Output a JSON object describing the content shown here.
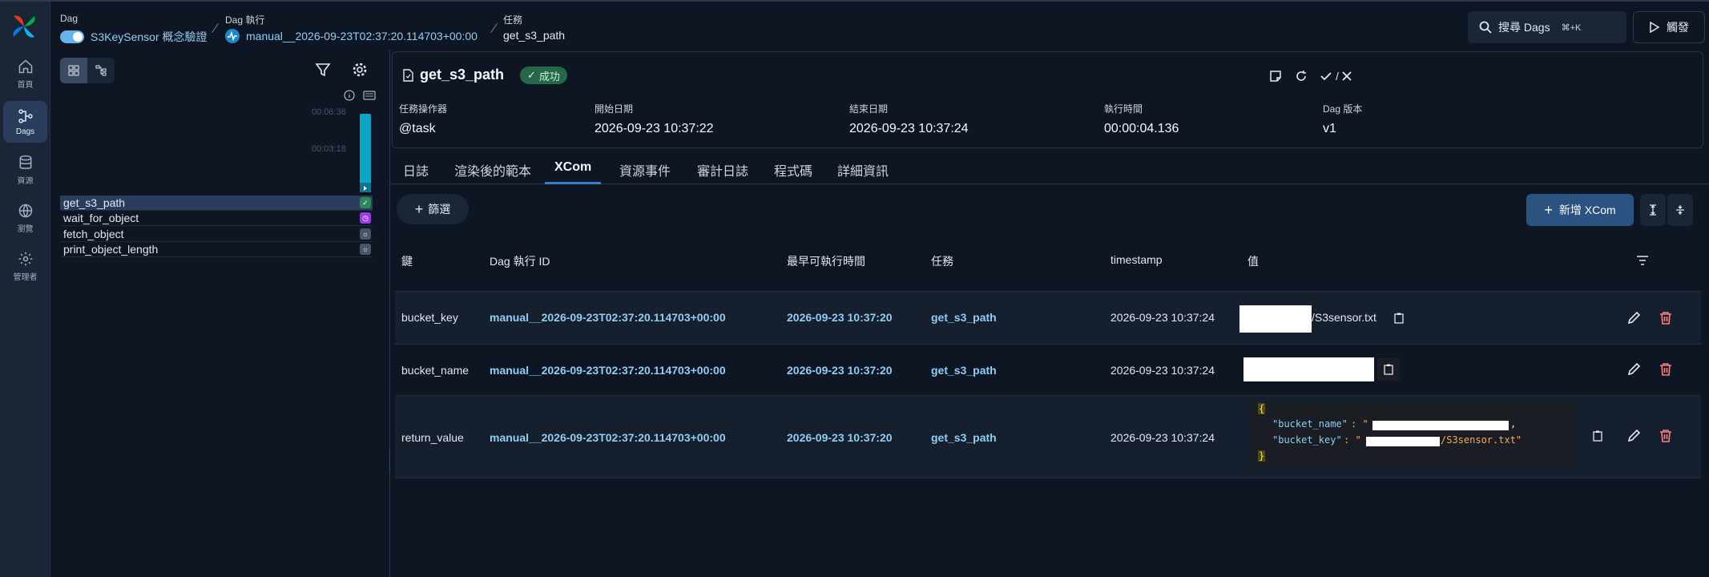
{
  "nav": {
    "items": [
      {
        "label": "首頁",
        "icon": "home-icon"
      },
      {
        "label": "Dags",
        "icon": "dag-icon",
        "active": true
      },
      {
        "label": "資源",
        "icon": "database-icon"
      },
      {
        "label": "瀏覽",
        "icon": "globe-icon"
      },
      {
        "label": "管理者",
        "icon": "gear-icon"
      }
    ]
  },
  "header": {
    "dag_label": "Dag",
    "dag_name": "S3KeySensor 概念驗證",
    "run_label": "Dag 執行",
    "run_id": "manual__2026-09-23T02:37:20.114703+00:00",
    "task_label": "任務",
    "task_id": "get_s3_path",
    "search_label": "搜尋 Dags",
    "search_shortcut": "⌘+K",
    "trigger_label": "觸發"
  },
  "grid": {
    "duration_ticks": [
      "00:06:36",
      "00:03:18"
    ],
    "tasks": [
      "get_s3_path",
      "wait_for_object",
      "fetch_object",
      "print_object_length"
    ]
  },
  "task": {
    "title": "get_s3_path",
    "status": "成功",
    "meta": [
      {
        "label": "任務操作器",
        "value": "@task"
      },
      {
        "label": "開始日期",
        "value": "2026-09-23 10:37:22"
      },
      {
        "label": "結束日期",
        "value": "2026-09-23 10:37:24"
      },
      {
        "label": "執行時間",
        "value": "00:00:04.136"
      },
      {
        "label": "Dag 版本",
        "value": "v1"
      }
    ],
    "mark_label": "/"
  },
  "tabs": [
    "日誌",
    "渲染後的範本",
    "XCom",
    "資源事件",
    "審計日誌",
    "程式碼",
    "詳細資訊"
  ],
  "xcom": {
    "filter_label": "篩選",
    "add_label": "新增 XCom",
    "columns": [
      "鍵",
      "Dag 執行 ID",
      "最早可執行時間",
      "任務",
      "timestamp",
      "值"
    ],
    "rows": [
      {
        "key": "bucket_key",
        "run_id": "manual__2026-09-23T02:37:20.114703+00:00",
        "logical_date": "2026-09-23 10:37:20",
        "task": "get_s3_path",
        "timestamp": "2026-09-23 10:37:24",
        "value_suffix": "/S3sensor.txt"
      },
      {
        "key": "bucket_name",
        "run_id": "manual__2026-09-23T02:37:20.114703+00:00",
        "logical_date": "2026-09-23 10:37:20",
        "task": "get_s3_path",
        "timestamp": "2026-09-23 10:37:24",
        "value_suffix": ""
      },
      {
        "key": "return_value",
        "run_id": "manual__2026-09-23T02:37:20.114703+00:00",
        "logical_date": "2026-09-23 10:37:20",
        "task": "get_s3_path",
        "timestamp": "2026-09-23 10:37:24",
        "json": {
          "open": "{",
          "k1": "\"bucket_name\"",
          "v1_prefix": ": \"",
          "v1_suffix": ",",
          "k2": "\"bucket_key\"",
          "v2_prefix": ": \"",
          "v2_suffix": "/S3sensor.txt\"",
          "close": "}"
        }
      }
    ]
  },
  "colors": {
    "accent": "#3182ce",
    "link": "#90cdf4",
    "success": "#276749"
  }
}
